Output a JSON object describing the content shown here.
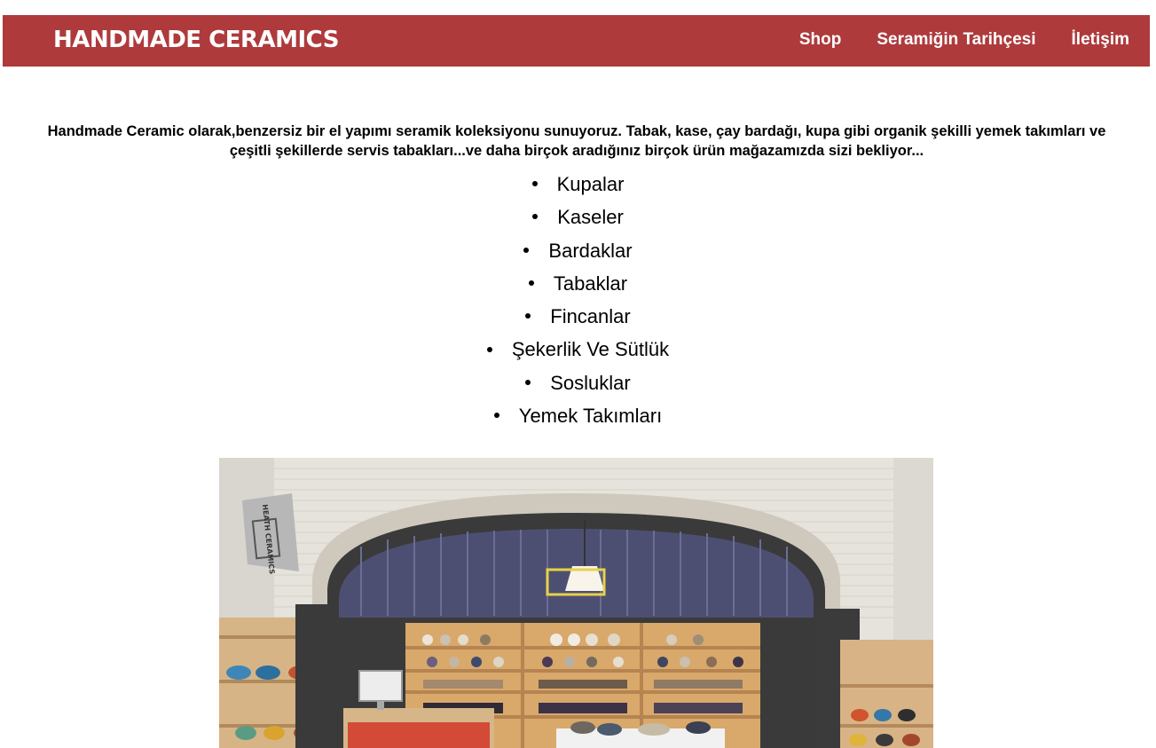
{
  "header": {
    "brand": "HANDMADE CERAMICS",
    "nav": [
      {
        "label": "Shop"
      },
      {
        "label": "Seramiğin Tarihçesi"
      },
      {
        "label": "İletişim"
      }
    ]
  },
  "intro_text": "Handmade Ceramic olarak,benzersiz bir el yapımı seramik koleksiyonu sunuyoruz. Tabak, kase, çay bardağı, kupa gibi organik şekilli yemek takımları ve çeşitli şekillerde servis tabakları...ve daha birçok aradığınız birçok ürün mağazamızda sizi bekliyor...",
  "categories": [
    {
      "label": "Kupalar"
    },
    {
      "label": "Kaseler"
    },
    {
      "label": "Bardaklar"
    },
    {
      "label": "Tabaklar"
    },
    {
      "label": "Fincanlar"
    },
    {
      "label": "Şekerlik Ve Sütlük"
    },
    {
      "label": "Sosluklar"
    },
    {
      "label": "Yemek Takımları"
    }
  ],
  "store_image": {
    "sign_text": "HEATH CERAMICS"
  },
  "colors": {
    "navbar": "#ae3a3c",
    "nav_text": "#ffffff"
  }
}
